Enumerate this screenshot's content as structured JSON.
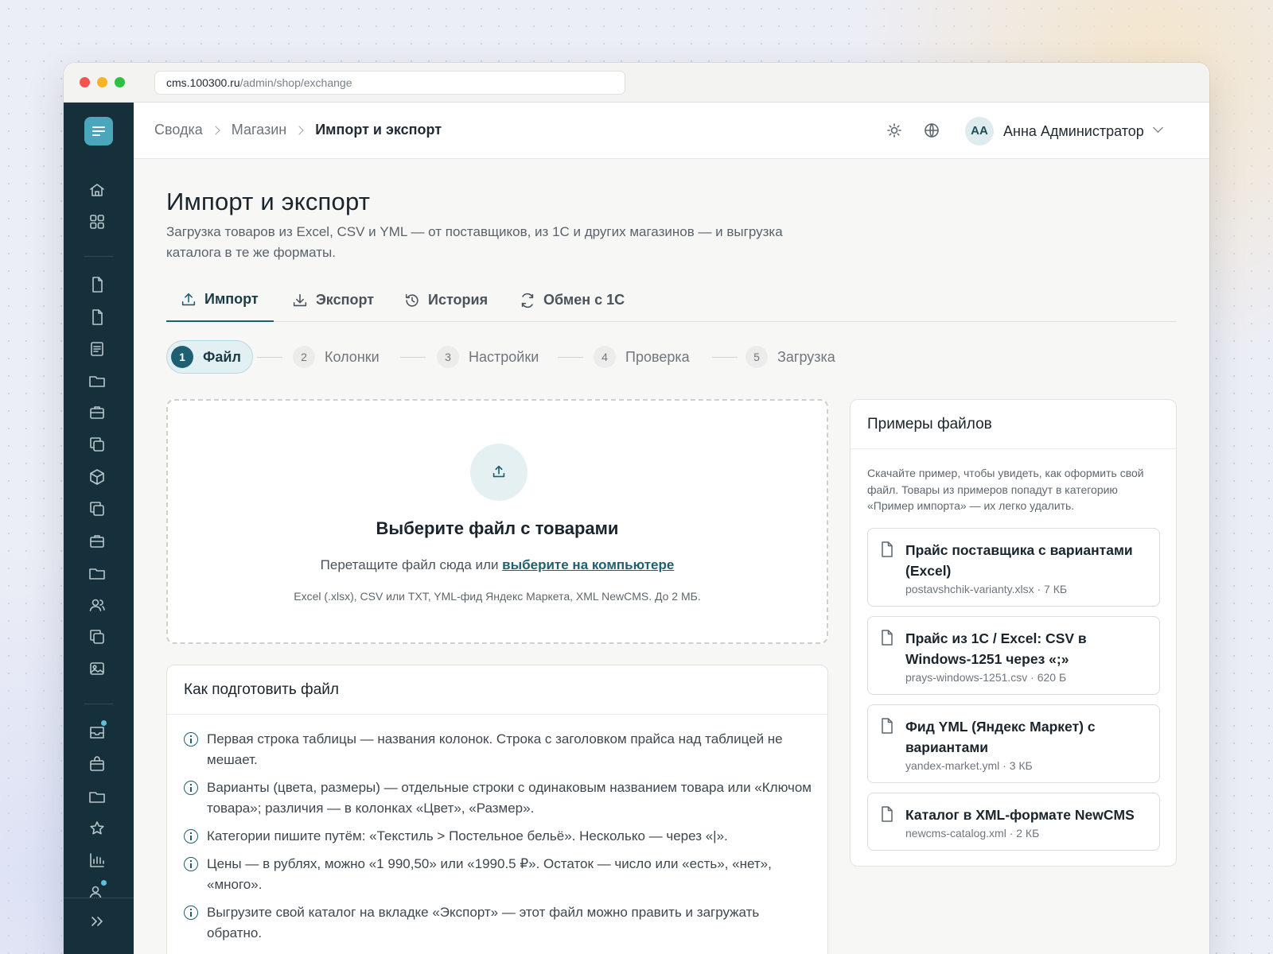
{
  "browser": {
    "url_host": "cms.100300.ru",
    "url_path": "/admin/shop/exchange"
  },
  "sidebar": {
    "icons": [
      "home-icon",
      "grid-icon",
      "file-icon",
      "file-icon",
      "list-icon",
      "folder-icon",
      "briefcase-icon",
      "copy-icon",
      "box-icon",
      "copy-icon",
      "briefcase-icon",
      "folder-icon",
      "users-icon",
      "copy-icon",
      "image-icon",
      "inbox-icon",
      "bag-icon",
      "folder-icon",
      "star-icon",
      "chart-icon",
      "users-icon",
      "expand-icon"
    ],
    "accent": "#4aa6ba",
    "bg": "#15303b"
  },
  "topbar": {
    "breadcrumbs": [
      "Сводка",
      "Магазин",
      "Импорт и экспорт"
    ],
    "user_initials": "АА",
    "user_name": "Анна Администратор"
  },
  "page": {
    "title": "Импорт и экспорт",
    "subtitle": "Загрузка товаров из Excel, CSV и YML — от поставщиков, из 1С и других магазинов — и выгрузка каталога в те же форматы."
  },
  "tabs": [
    {
      "label": "Импорт",
      "active": true
    },
    {
      "label": "Экспорт"
    },
    {
      "label": "История"
    },
    {
      "label": "Обмен с 1С"
    }
  ],
  "steps": [
    {
      "num": "1",
      "label": "Файл",
      "active": true
    },
    {
      "num": "2",
      "label": "Колонки"
    },
    {
      "num": "3",
      "label": "Настройки"
    },
    {
      "num": "4",
      "label": "Проверка"
    },
    {
      "num": "5",
      "label": "Загрузка"
    }
  ],
  "dropzone": {
    "title": "Выберите файл с товарами",
    "text_before": "Перетащите файл сюда или ",
    "link": "выберите на компьютере",
    "hint": "Excel (.xlsx), CSV или TXT, YML-фид Яндекс Маркета, XML NewCMS. До 2 МБ."
  },
  "howto": {
    "title": "Как подготовить файл",
    "tips": [
      "Первая строка таблицы — названия колонок. Строка с заголовком прайса над таблицей не мешает.",
      "Варианты (цвета, размеры) — отдельные строки с одинаковым названием товара или «Ключом товара»; различия — в колонках «Цвет», «Размер».",
      "Категории пишите путём: «Текстиль > Постельное бельё». Несколько — через «|».",
      "Цены — в рублях, можно «1 990,50» или «1990.5 ₽». Остаток — число или «есть», «нет», «много».",
      "Выгрузите свой каталог на вкладке «Экспорт» — этот файл можно править и загружать обратно."
    ]
  },
  "examples": {
    "title": "Примеры файлов",
    "description": "Скачайте пример, чтобы увидеть, как оформить свой файл. Товары из примеров попадут в категорию «Пример импорта» — их легко удалить.",
    "files": [
      {
        "name": "Прайс поставщика с вариантами (Excel)",
        "meta": "postavshchik-varianty.xlsx · 7 КБ"
      },
      {
        "name": "Прайс из 1С / Excel: CSV в Windows-1251 через «;»",
        "meta": "prays-windows-1251.csv · 620 Б"
      },
      {
        "name": "Фид YML (Яндекс Маркет) с вариантами",
        "meta": "yandex-market.yml · 3 КБ"
      },
      {
        "name": "Каталог в XML-формате NewCMS",
        "meta": "newcms-catalog.xml · 2 КБ"
      }
    ]
  }
}
